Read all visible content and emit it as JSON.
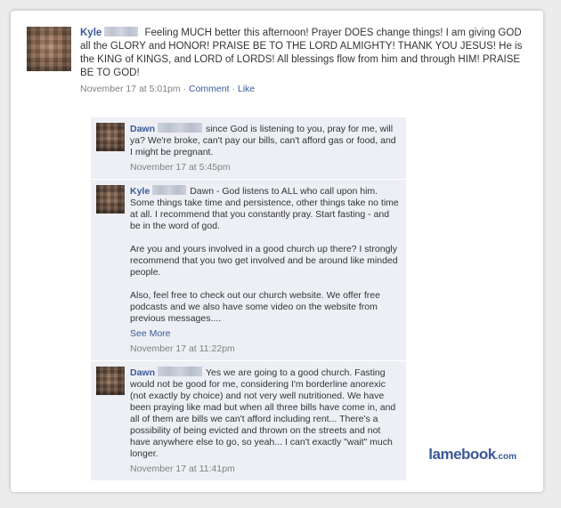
{
  "post": {
    "author": "Kyle",
    "text": "Feeling MUCH better this afternoon! Prayer DOES change things! I am giving GOD all the GLORY and HONOR! PRAISE BE TO THE LORD ALMIGHTY! THANK YOU JESUS! He is the KING of KINGS, and LORD of LORDS! All blessings flow from him and through HIM! PRAISE BE TO GOD!",
    "timestamp": "November 17 at 5:01pm",
    "separator": "·",
    "comment_label": "Comment",
    "like_label": "Like"
  },
  "comments": [
    {
      "author": "Dawn",
      "paragraphs": [
        "since God is listening to you, pray for me, will ya? We're broke, can't pay our bills, can't afford gas or food, and I might be pregnant."
      ],
      "timestamp": "November 17 at 5:45pm"
    },
    {
      "author": "Kyle",
      "paragraphs": [
        "Dawn - God listens to ALL who call upon him. Some things take time and persistence, other things take no time at all. I recommend that you constantly pray. Start fasting - and be in the word of god.",
        "Are you and yours involved in a good church up there? I strongly recommend that you two get involved and be around like minded people.",
        "Also, feel free to check out our church website. We offer free podcasts and we also have some video on the website from previous messages...."
      ],
      "see_more": "See More",
      "timestamp": "November 17 at 11:22pm"
    },
    {
      "author": "Dawn",
      "paragraphs": [
        "Yes we are going to a good church. Fasting would not be good for me, considering I'm borderline anorexic (not exactly by choice) and not very well nutritioned. We have been praying like mad but when all three bills have come in, and all of them are bills we can't afford including rent... There's a possibility of being evicted and thrown on the streets and not have anywhere else to go, so yeah... I can't exactly \"wait\" much longer."
      ],
      "timestamp": "November 17 at 11:41pm"
    }
  ],
  "logo": {
    "main": "lamebook",
    "suffix": ".com"
  }
}
